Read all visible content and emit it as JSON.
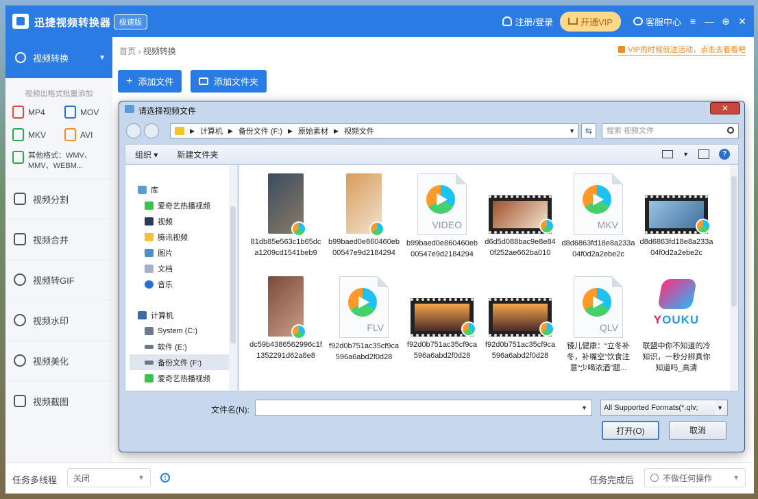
{
  "app": {
    "title": "迅捷视频转换器",
    "edition": "极速版",
    "login": "注册/登录",
    "vip": "开通VIP",
    "service": "客服中心",
    "window_controls": [
      "≡",
      "—",
      "⊕",
      "✕"
    ]
  },
  "sidebar": {
    "active": {
      "label": "视频转换",
      "icon": "convert-icon"
    },
    "format_hint": "视频出格式批量添加",
    "formats": [
      {
        "label": "MP4",
        "color": "#e04a3a"
      },
      {
        "label": "MOV",
        "color": "#2b6fd6"
      },
      {
        "label": "MKV",
        "color": "#2aa84a"
      },
      {
        "label": "AVI",
        "color": "#f08a24"
      }
    ],
    "other_formats": "其他格式：WMV、MMV、WEBM...",
    "items": [
      {
        "label": "视频分割",
        "icon": "split-icon"
      },
      {
        "label": "视频合并",
        "icon": "merge-icon"
      },
      {
        "label": "视频转GIF",
        "icon": "gif-icon"
      },
      {
        "label": "视频水印",
        "icon": "watermark-icon"
      },
      {
        "label": "视频美化",
        "icon": "beautify-icon"
      },
      {
        "label": "视频截图",
        "icon": "screenshot-icon"
      }
    ]
  },
  "main": {
    "breadcrumb": {
      "home": "首页",
      "current": "视频转换"
    },
    "promo": "VIP的时候就送活动，点击去看看吧",
    "add_file": "添加文件",
    "add_folder": "添加文件夹"
  },
  "bottom": {
    "task_label": "任务多线程",
    "task_value": "关闭",
    "complete_label": "任务完成后",
    "complete_value": "不做任何操作"
  },
  "dialog": {
    "title": "请选择视频文件",
    "close": "✕",
    "path": [
      "计算机",
      "备份文件 (F:)",
      "原始素材",
      "视频文件"
    ],
    "search_placeholder": "搜索 视频文件",
    "organize": "组织 ▾",
    "new_folder": "新建文件夹",
    "tree": {
      "library": "库",
      "library_items": [
        {
          "label": "爱奇艺热播视频",
          "color": "#35c24d"
        },
        {
          "label": "视频",
          "color": "#2b3a55"
        },
        {
          "label": "腾讯视频",
          "color": "#f1c232"
        },
        {
          "label": "图片",
          "color": "#4a90c8"
        },
        {
          "label": "文档",
          "color": "#9fb2c8"
        },
        {
          "label": "音乐",
          "color": "#2b6fd6"
        }
      ],
      "computer": "计算机",
      "computer_items": [
        {
          "label": "System (C:)",
          "color": "#6a7a8a"
        },
        {
          "label": "软件 (E:)",
          "color": "#6a7a8a"
        },
        {
          "label": "备份文件 (F:)",
          "color": "#6a7a8a",
          "selected": true
        },
        {
          "label": "爱奇艺热播视频",
          "color": "#35c24d"
        }
      ]
    },
    "files": [
      {
        "name": "81db85e563c1b65dca1209cd1541beb9",
        "kind": "video"
      },
      {
        "name": "b99baed0e860460eb00547e9d2184294",
        "kind": "video"
      },
      {
        "name": "b99baed0e860460eb00547e9d2184294",
        "kind": "doc",
        "ext": "VIDEO"
      },
      {
        "name": "d6d5d088bac9e8e840f252ae662ba010",
        "kind": "film"
      },
      {
        "name": "d8d6863fd18e8a233a04f0d2a2ebe2c",
        "kind": "doc",
        "ext": "MKV"
      },
      {
        "name": "d8d6863fd18e8a233a04f0d2a2ebe2c",
        "kind": "film"
      },
      {
        "name": "dc59b4386562996c1f1352291d62a8e8",
        "kind": "video"
      },
      {
        "name": "f92d0b751ac35cf9ca596a6abd2f0d28",
        "kind": "doc",
        "ext": "FLV"
      },
      {
        "name": "f92d0b751ac35cf9ca596a6abd2f0d28",
        "kind": "film"
      },
      {
        "name": "f92d0b751ac35cf9ca596a6abd2f0d28",
        "kind": "film"
      },
      {
        "name": "镜儿健康：“立冬补冬，补嘴空”饮食注意“少喝浓酒”题...",
        "kind": "doc",
        "ext": "QLV"
      },
      {
        "name": "联盟中你不知道的冷知识，一秒分辨真你知道吗_高清",
        "kind": "youku"
      }
    ],
    "youku_text": {
      "y": "Y",
      "rest": "OUKU"
    },
    "filename_label": "文件名(N):",
    "filename_value": "",
    "filter": "All Supported Formats(*.qlv;",
    "open": "打开(O)",
    "cancel": "取消"
  }
}
